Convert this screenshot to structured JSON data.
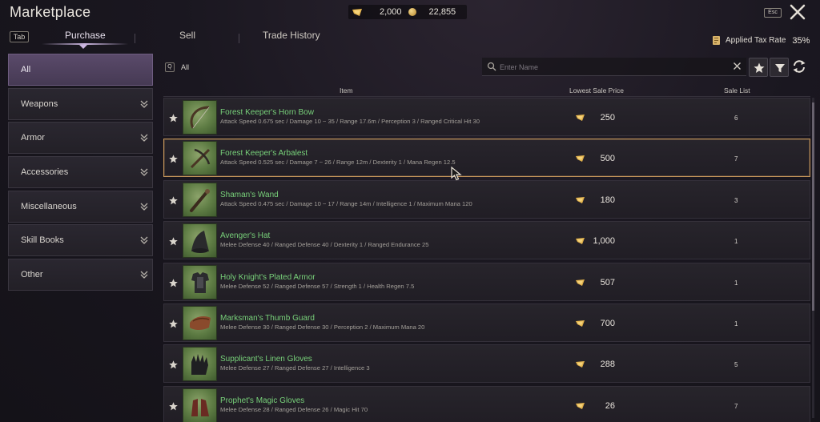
{
  "window": {
    "title": "Marketplace",
    "esc_label": "Esc"
  },
  "currency": {
    "primary": "2,000",
    "secondary": "22,855"
  },
  "tabs": {
    "key_hint": "Tab",
    "items": [
      {
        "label": "Purchase",
        "active": true
      },
      {
        "label": "Sell",
        "active": false
      },
      {
        "label": "Trade History",
        "active": false
      }
    ]
  },
  "tax": {
    "label": "Applied Tax Rate",
    "value": "35%"
  },
  "sidebar": {
    "items": [
      {
        "label": "All",
        "active": true
      },
      {
        "label": "Weapons"
      },
      {
        "label": "Armor"
      },
      {
        "label": "Accessories"
      },
      {
        "label": "Miscellaneous"
      },
      {
        "label": "Skill Books"
      },
      {
        "label": "Other"
      }
    ]
  },
  "filter": {
    "key_hint": "Q",
    "label": "All"
  },
  "search": {
    "placeholder": "Enter Name",
    "value": ""
  },
  "table": {
    "headers": {
      "item": "Item",
      "price": "Lowest Sale Price",
      "list": "Sale List"
    },
    "rows": [
      {
        "name": "Forest Keeper's Horn Bow",
        "stats": "Attack Speed 0.675 sec / Damage 10 ~ 35 / Range 17.6m / Perception 3 / Ranged Critical Hit 30",
        "price": "250",
        "count": "6",
        "icon": "bow-icon"
      },
      {
        "name": "Forest Keeper's Arbalest",
        "stats": "Attack Speed 0.525 sec / Damage 7 ~ 26 / Range 12m / Dexterity 1 / Mana Regen 12.5",
        "price": "500",
        "count": "7",
        "icon": "crossbow-icon",
        "selected": true
      },
      {
        "name": "Shaman's Wand",
        "stats": "Attack Speed 0.475 sec / Damage 10 ~ 17 / Range 14m / Intelligence 1 / Maximum Mana 120",
        "price": "180",
        "count": "3",
        "icon": "wand-icon"
      },
      {
        "name": "Avenger's Hat",
        "stats": "Melee Defense 40 / Ranged Defense 40 / Dexterity 1 / Ranged Endurance 25",
        "price": "1,000",
        "count": "1",
        "icon": "hat-icon"
      },
      {
        "name": "Holy Knight's Plated Armor",
        "stats": "Melee Defense 52 / Ranged Defense 57 / Strength 1 / Health Regen 7.5",
        "price": "507",
        "count": "1",
        "icon": "armor-icon"
      },
      {
        "name": "Marksman's Thumb Guard",
        "stats": "Melee Defense 30 / Ranged Defense 30 / Perception 2 / Maximum Mana 20",
        "price": "700",
        "count": "1",
        "icon": "thumb-guard-icon"
      },
      {
        "name": "Supplicant's Linen Gloves",
        "stats": "Melee Defense 27 / Ranged Defense 27 / Intelligence 3",
        "price": "288",
        "count": "5",
        "icon": "gloves-icon"
      },
      {
        "name": "Prophet's Magic Gloves",
        "stats": "Melee Defense 28 / Ranged Defense 26 / Magic Hit 70",
        "price": "26",
        "count": "7",
        "icon": "gloves-icon"
      }
    ]
  },
  "colors": {
    "item_name": "#78d17a",
    "selected_border": "#c4955a",
    "active_category": "#5a4a6a",
    "thumb_bg": "#6f8f51"
  }
}
